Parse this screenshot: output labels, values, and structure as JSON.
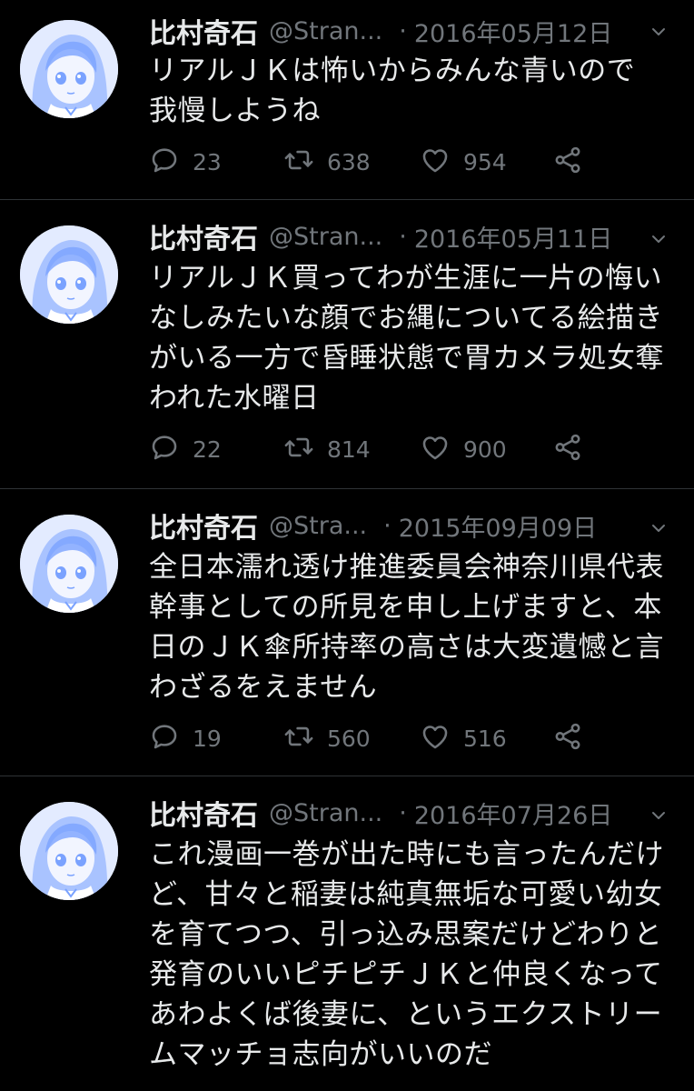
{
  "colors": {
    "background": "#000000",
    "text": "#e7e9ea",
    "muted": "#71767b",
    "divider": "#2f3336",
    "avatar_tint": "#7aa2ff"
  },
  "tweets": [
    {
      "name": "比村奇石",
      "handle": "@Stran...",
      "sep": "·",
      "date": "2016年05月12日",
      "text": "リアルＪＫは怖いからみんな青いので我慢しようね",
      "replies": "23",
      "retweets": "638",
      "likes": "954"
    },
    {
      "name": "比村奇石",
      "handle": "@Stran...",
      "sep": "·",
      "date": "2016年05月11日",
      "text": "リアルＪＫ買ってわが生涯に一片の悔いなしみたいな顔でお縄についてる絵描きがいる一方で昏睡状態で胃カメラ処女奪われた水曜日",
      "replies": "22",
      "retweets": "814",
      "likes": "900"
    },
    {
      "name": "比村奇石",
      "handle": "@Stra...",
      "sep": "·",
      "date": "2015年09月09日",
      "text": "全日本濡れ透け推進委員会神奈川県代表幹事としての所見を申し上げますと、本日のＪＫ傘所持率の高さは大変遺憾と言わざるをえません",
      "replies": "19",
      "retweets": "560",
      "likes": "516"
    },
    {
      "name": "比村奇石",
      "handle": "@Stran...",
      "sep": "·",
      "date": "2016年07月26日",
      "text": "これ漫画一巻が出た時にも言ったんだけど、甘々と稲妻は純真無垢な可愛い幼女を育てつつ、引っ込み思案だけどわりと発育のいいピチピチＪＫと仲良くなってあわよくば後妻に、というエクストリームマッチョ志向がいいのだ",
      "replies": "",
      "retweets": "",
      "likes": ""
    }
  ]
}
